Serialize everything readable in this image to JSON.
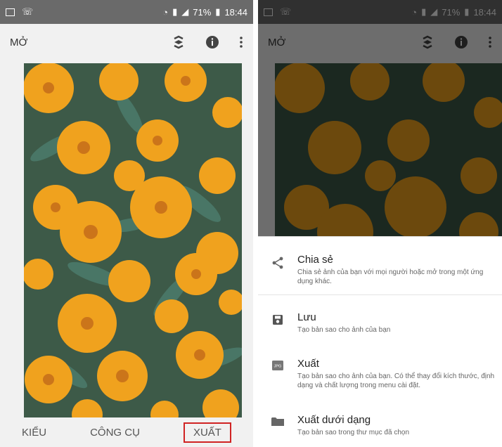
{
  "status": {
    "battery": "71%",
    "time": "18:44"
  },
  "left": {
    "title": "MỞ",
    "nav": {
      "styles": "KIỂU",
      "tools": "CÔNG CỤ",
      "export": "XUẤT"
    }
  },
  "right": {
    "title": "MỞ",
    "menu": [
      {
        "icon": "share-icon",
        "title": "Chia sẻ",
        "desc": "Chia sẻ ảnh của bạn với mọi người hoặc mở trong một ứng dụng khác."
      },
      {
        "icon": "save-icon",
        "title": "Lưu",
        "desc": "Tạo bản sao cho ảnh của bạn"
      },
      {
        "icon": "jpg-icon",
        "title": "Xuất",
        "desc": "Tạo bản sao cho ảnh của bạn. Có thể thay đổi kích thước, định dạng và chất lượng trong menu cài đặt."
      },
      {
        "icon": "folder-icon",
        "title": "Xuất dưới dạng",
        "desc": "Tạo bản sao trong thư mục đã chọn"
      }
    ]
  },
  "colors": {
    "accent_red": "#d02323",
    "status_bar": "#6a6a6a",
    "petal": "#f0a21e"
  }
}
